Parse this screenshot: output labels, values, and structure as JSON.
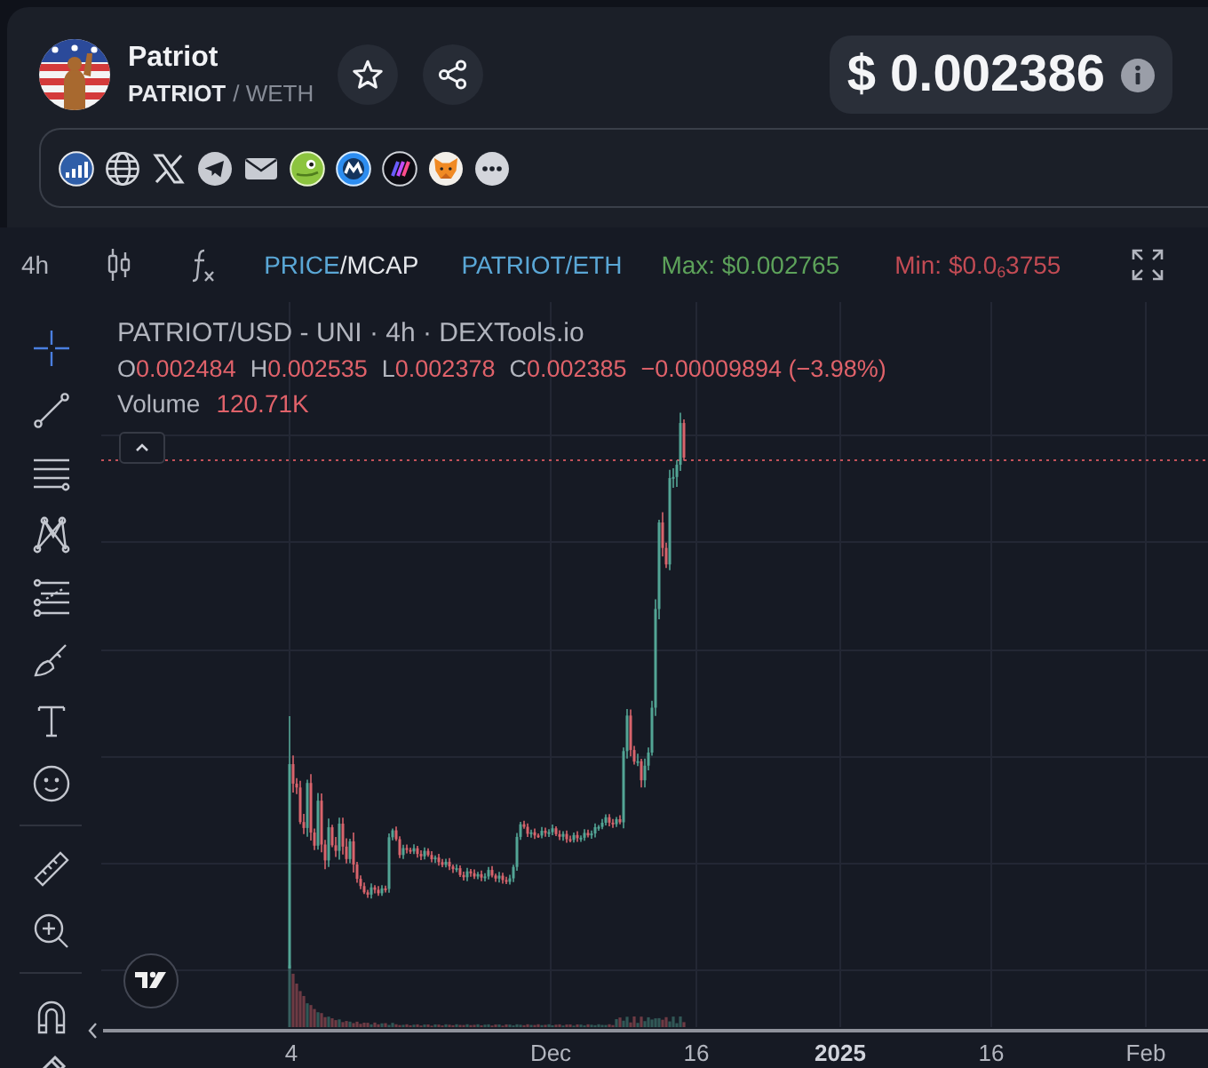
{
  "token": {
    "name": "Patriot",
    "symbol": "PATRIOT",
    "quote": "/ WETH"
  },
  "price": {
    "value": "$ 0.002386"
  },
  "chart_toolbar": {
    "interval": "4h",
    "price_modes": [
      {
        "label": "PRICE",
        "selected": true
      },
      {
        "label": "MCAP",
        "selected": false
      }
    ],
    "mode_separator": "/",
    "pair": "PATRIOT/ETH",
    "max": "Max: $0.002765",
    "min": "Min: $0.0$_{6}$3755"
  },
  "drawing_tools": [
    {
      "tools": [
        {
          "selected": true
        },
        {
          "selected": false
        },
        {
          "selected": false
        },
        {
          "selected": false
        },
        {
          "selected": false
        },
        {
          "selected": false
        },
        {
          "selected": false
        },
        {
          "selected": false
        }
      ]
    },
    {
      "tools": [
        {
          "selected": false
        },
        {
          "selected": false
        }
      ]
    },
    {
      "tools": [
        {
          "selected": false
        },
        {
          "selected": false
        }
      ]
    }
  ],
  "legend": {
    "title": "PATRIOT/USD - UNI · 4h · DEXTools.io",
    "falling": true,
    "ohlc": [
      {
        "label": "O",
        "value": "0.002484"
      },
      {
        "label": "H",
        "value": "0.002535"
      },
      {
        "label": "L",
        "value": "0.002378"
      },
      {
        "label": "C",
        "value": "0.002385"
      }
    ],
    "change": "−0.00009894 (−3.98%)",
    "volume_label": "Volume",
    "volume_value": "120.71K"
  },
  "time_axis": [
    {
      "text": "4",
      "emphasized": false
    },
    {
      "text": "Dec",
      "emphasized": false
    },
    {
      "text": "16",
      "emphasized": false
    },
    {
      "text": "2025",
      "emphasized": true
    },
    {
      "text": "16",
      "emphasized": false
    },
    {
      "text": "Feb",
      "emphasized": false
    }
  ]
}
